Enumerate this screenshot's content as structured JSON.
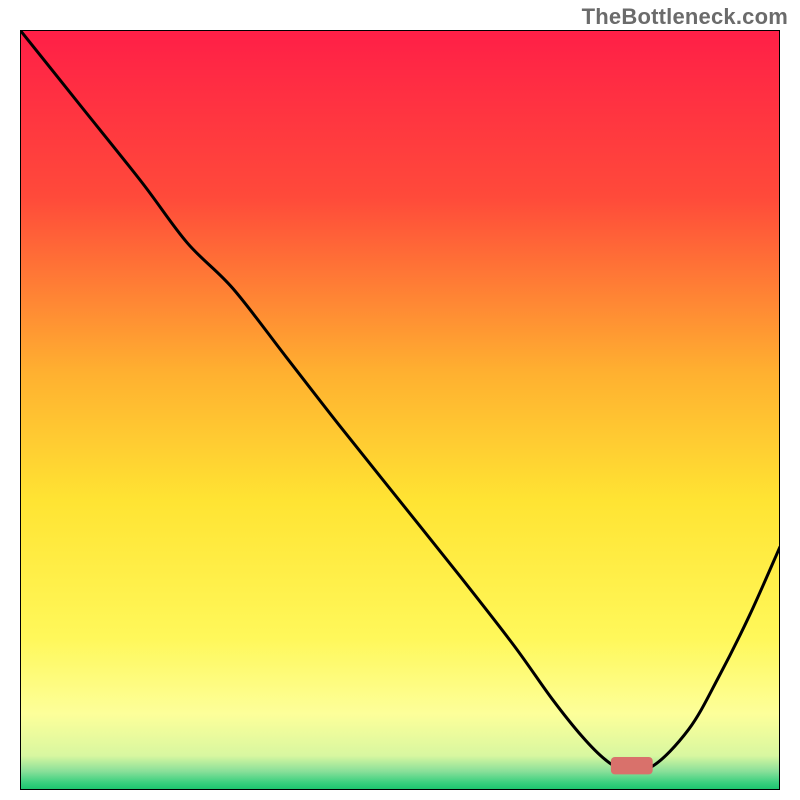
{
  "watermark": "TheBottleneck.com",
  "chart_data": {
    "type": "line",
    "title": "",
    "xlabel": "",
    "ylabel": "",
    "xlim": [
      0,
      100
    ],
    "ylim": [
      0,
      100
    ],
    "grid": false,
    "legend": false,
    "gradient_stops": [
      {
        "offset": 0.0,
        "color": "#ff1f47"
      },
      {
        "offset": 0.22,
        "color": "#ff4a3a"
      },
      {
        "offset": 0.45,
        "color": "#ffb030"
      },
      {
        "offset": 0.62,
        "color": "#ffe433"
      },
      {
        "offset": 0.8,
        "color": "#fff85a"
      },
      {
        "offset": 0.9,
        "color": "#fdff9a"
      },
      {
        "offset": 0.955,
        "color": "#d8f7a0"
      },
      {
        "offset": 0.975,
        "color": "#8be09a"
      },
      {
        "offset": 0.99,
        "color": "#3bd07f"
      },
      {
        "offset": 1.0,
        "color": "#18c46c"
      }
    ],
    "series": [
      {
        "name": "curve",
        "stroke": "#000000",
        "stroke_width": 3,
        "x": [
          0,
          8,
          16,
          22,
          28,
          35,
          42,
          50,
          58,
          65,
          70,
          74,
          77,
          79,
          83,
          88,
          92,
          96,
          100
        ],
        "y": [
          100,
          90,
          80,
          72,
          66,
          57,
          48,
          38,
          28,
          19,
          12,
          7,
          4,
          3,
          3,
          8,
          15,
          23,
          32
        ]
      }
    ],
    "marker": {
      "name": "target-marker",
      "shape": "rounded-rect",
      "color": "#d9716b",
      "x": 80.5,
      "y": 3.2,
      "w": 5.5,
      "h": 2.3
    }
  }
}
